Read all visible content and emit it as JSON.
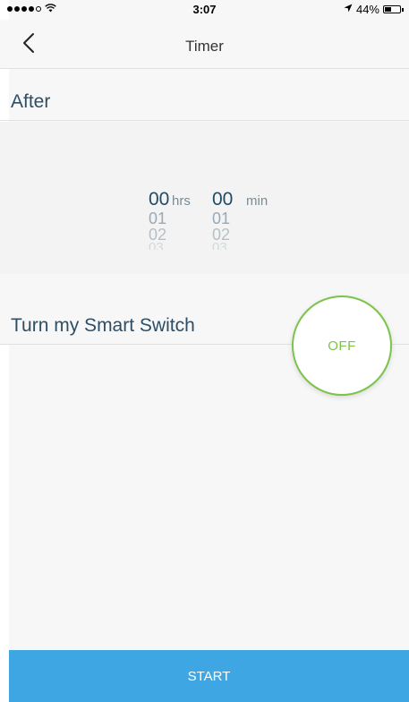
{
  "status_bar": {
    "time": "3:07",
    "battery_percent": "44%",
    "battery_level": 0.44,
    "signal_filled": 4,
    "signal_total": 5,
    "wifi_icon": "wifi-icon",
    "location_icon": "location-arrow-icon"
  },
  "nav": {
    "title": "Timer",
    "back_icon": "chevron-left-icon"
  },
  "after_section": {
    "label": "After"
  },
  "picker": {
    "hours": {
      "unit": "hrs",
      "options": [
        "00",
        "01",
        "02",
        "03"
      ],
      "selected": "00"
    },
    "minutes": {
      "unit": "min",
      "options": [
        "00",
        "01",
        "02",
        "03"
      ],
      "selected": "00"
    }
  },
  "switch_section": {
    "label": "Turn my Smart Switch",
    "toggle_state": "OFF"
  },
  "footer": {
    "start_label": "START"
  },
  "colors": {
    "accent_blue": "#3ea7e3",
    "toggle_green": "#7cc34a",
    "text_navy": "#2e4e66"
  }
}
